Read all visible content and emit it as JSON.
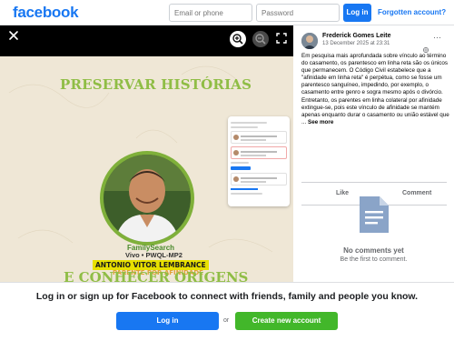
{
  "header": {
    "logo": "facebook",
    "email_placeholder": "Email or phone",
    "password_placeholder": "Password",
    "login_label": "Log in",
    "forgot_label": "Forgotten account?"
  },
  "photo": {
    "headline": "PRESERVAR HISTÓRIAS",
    "headline_bottom": "E CONHECER ORIGENS",
    "brand": "FamilySearch",
    "person_id": "Vivo • PWQL-MP2",
    "person_name": "ANTONIO VITOR LEMBRANCE",
    "relation": "PARENTE POR AFINIDADE"
  },
  "post": {
    "author": "Frederick Gomes Leite",
    "date": "13 December 2025 at 23:31",
    "text": "Em pesquisa mais aprofundada sobre vínculo ao término do casamento, os parentesco em linha reta são os únicos que permanecem. O Código Civil estabelece que a \"afinidade em linha reta\" é perpétua, como se fosse um parentesco sanguíneo, impedindo, por exemplo, o casamento entre genro e sogra mesmo após o divórcio. Entretanto, os parentes em linha colateral por afinidade extingue-se, pois este vínculo de afinidade se mantém apenas enquanto durar o casamento ou união estável que ...",
    "see_more": "See more",
    "like_label": "Like",
    "comment_label": "Comment",
    "no_comments": "No comments yet",
    "first_comment": "Be the first to comment."
  },
  "banner": {
    "text": "Log in or sign up for Facebook to connect with friends, family and people you know.",
    "login_label": "Log in",
    "or": "or",
    "create_label": "Create new account"
  },
  "colors": {
    "brand_blue": "#1877f2",
    "create_green": "#42b72a",
    "headline_green": "#8fbd45"
  },
  "icons": [
    "close-icon",
    "zoom-in-icon",
    "zoom-out-icon",
    "fullscreen-icon",
    "globe-icon",
    "more-icon",
    "document-icon"
  ]
}
